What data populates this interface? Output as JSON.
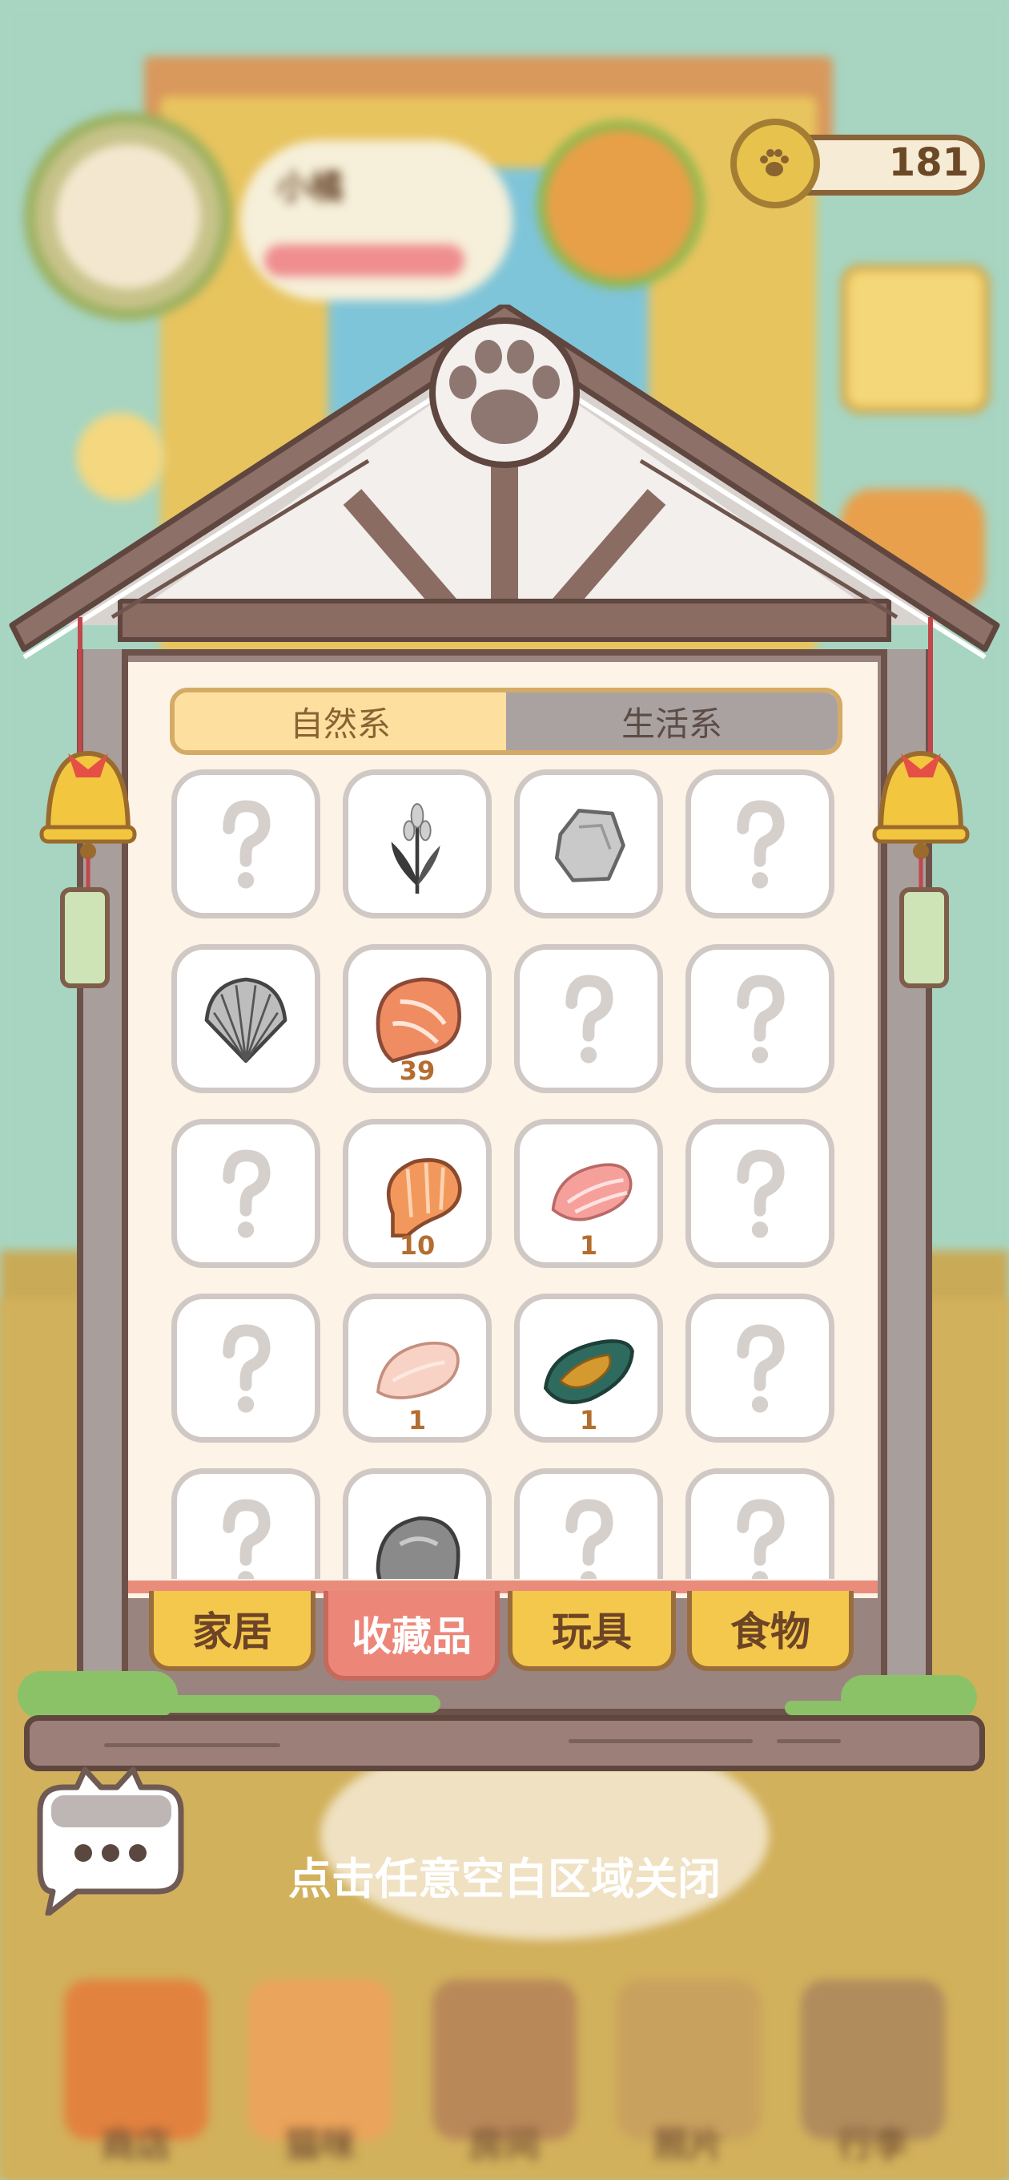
{
  "status": {
    "name": "小橘",
    "coins": "181"
  },
  "panel": {
    "subtabs": [
      {
        "label": "自然系",
        "active": true
      },
      {
        "label": "生活系",
        "active": false
      }
    ],
    "items": [
      {
        "icon": "unknown-item-icon",
        "count": ""
      },
      {
        "icon": "wheat-icon",
        "count": ""
      },
      {
        "icon": "stone-icon",
        "count": ""
      },
      {
        "icon": "unknown-item-icon",
        "count": ""
      },
      {
        "icon": "scallop-shell-icon",
        "count": ""
      },
      {
        "icon": "salmon-steak-icon",
        "count": "39"
      },
      {
        "icon": "unknown-item-icon",
        "count": ""
      },
      {
        "icon": "unknown-item-icon",
        "count": ""
      },
      {
        "icon": "unknown-item-icon",
        "count": ""
      },
      {
        "icon": "shrimp-icon",
        "count": "10"
      },
      {
        "icon": "tuna-slice-icon",
        "count": "1"
      },
      {
        "icon": "unknown-item-icon",
        "count": ""
      },
      {
        "icon": "unknown-item-icon",
        "count": ""
      },
      {
        "icon": "chicken-breast-icon",
        "count": "1"
      },
      {
        "icon": "mussel-icon",
        "count": "1"
      },
      {
        "icon": "unknown-item-icon",
        "count": ""
      },
      {
        "icon": "unknown-item-icon",
        "count": ""
      },
      {
        "icon": "grey-rock-icon",
        "count": ""
      },
      {
        "icon": "unknown-item-icon",
        "count": ""
      },
      {
        "icon": "unknown-item-icon",
        "count": ""
      }
    ],
    "categories": [
      {
        "label": "家居",
        "active": false
      },
      {
        "label": "收藏品",
        "active": true
      },
      {
        "label": "玩具",
        "active": false
      },
      {
        "label": "食物",
        "active": false
      }
    ]
  },
  "hint": "点击任意空白区域关闭",
  "bottom_nav": [
    {
      "label": "商店",
      "icon": "shop-bag-icon"
    },
    {
      "label": "猫咪",
      "icon": "cat-icon"
    },
    {
      "label": "房间",
      "icon": "house-icon"
    },
    {
      "label": "照片",
      "icon": "camera-icon"
    },
    {
      "label": "行李",
      "icon": "suitcase-icon"
    }
  ],
  "colors": {
    "accent_active_tab": "#ec8678",
    "category_tab": "#f4c84c",
    "count_text": "#b46d2e",
    "frame_brown": "#6d524a"
  }
}
